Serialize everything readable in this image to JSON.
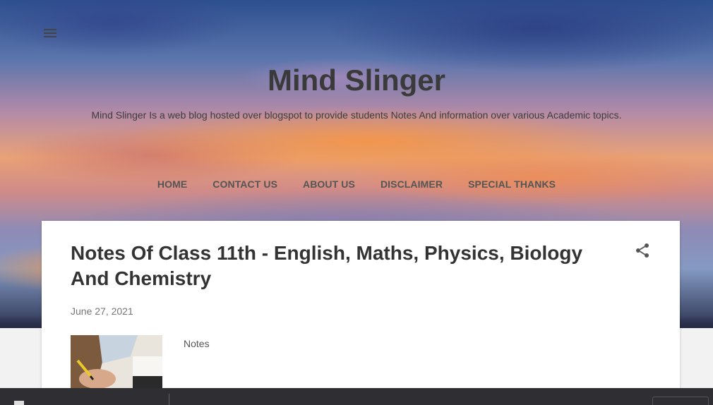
{
  "header": {
    "menu_icon": "hamburger-menu-icon",
    "title": "Mind Slinger",
    "description": "Mind Slinger Is a web blog hosted over blogspot to provide students Notes And information over various Academic topics."
  },
  "nav": {
    "items": [
      {
        "label": "HOME"
      },
      {
        "label": "CONTACT US"
      },
      {
        "label": "ABOUT US"
      },
      {
        "label": "DISCLAIMER"
      },
      {
        "label": "SPECIAL THANKS"
      }
    ]
  },
  "post": {
    "title": "Notes Of Class 11th - English, Maths, Physics, Biology And Chemistry",
    "date": "June 27, 2021",
    "label": "Notes",
    "share_icon": "share-icon"
  },
  "colors": {
    "title_text": "#3a3a3a",
    "nav_text": "#555555",
    "post_title": "#333333",
    "date_text": "#757575",
    "bottom_bar": "#2f2f33"
  }
}
